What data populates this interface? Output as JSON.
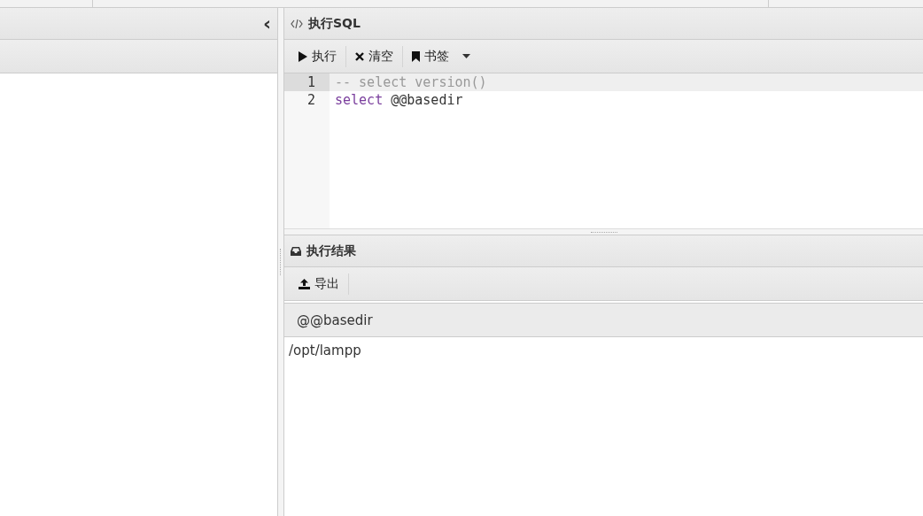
{
  "sidebar": {
    "collapse_icon": "‹"
  },
  "sql_panel": {
    "title": "执行SQL",
    "toolbar": [
      {
        "kind": "run",
        "label": "执行"
      },
      {
        "kind": "clear",
        "label": "清空"
      },
      {
        "kind": "bookmark",
        "label": "书签",
        "dropdown": true
      }
    ],
    "editor": {
      "lines": [
        {
          "number": "1",
          "selected": true,
          "tokens": [
            {
              "kind": "comment",
              "text": "-- select version()"
            }
          ]
        },
        {
          "number": "2",
          "selected": false,
          "tokens": [
            {
              "kind": "keyword",
              "text": "select"
            },
            {
              "kind": "plain",
              "text": " @@basedir"
            }
          ]
        }
      ]
    }
  },
  "result_panel": {
    "title": "执行结果",
    "toolbar": [
      {
        "kind": "export",
        "label": "导出"
      }
    ],
    "table": {
      "columns": [
        "@@basedir"
      ],
      "rows": [
        [
          "/opt/lampp"
        ]
      ]
    }
  }
}
